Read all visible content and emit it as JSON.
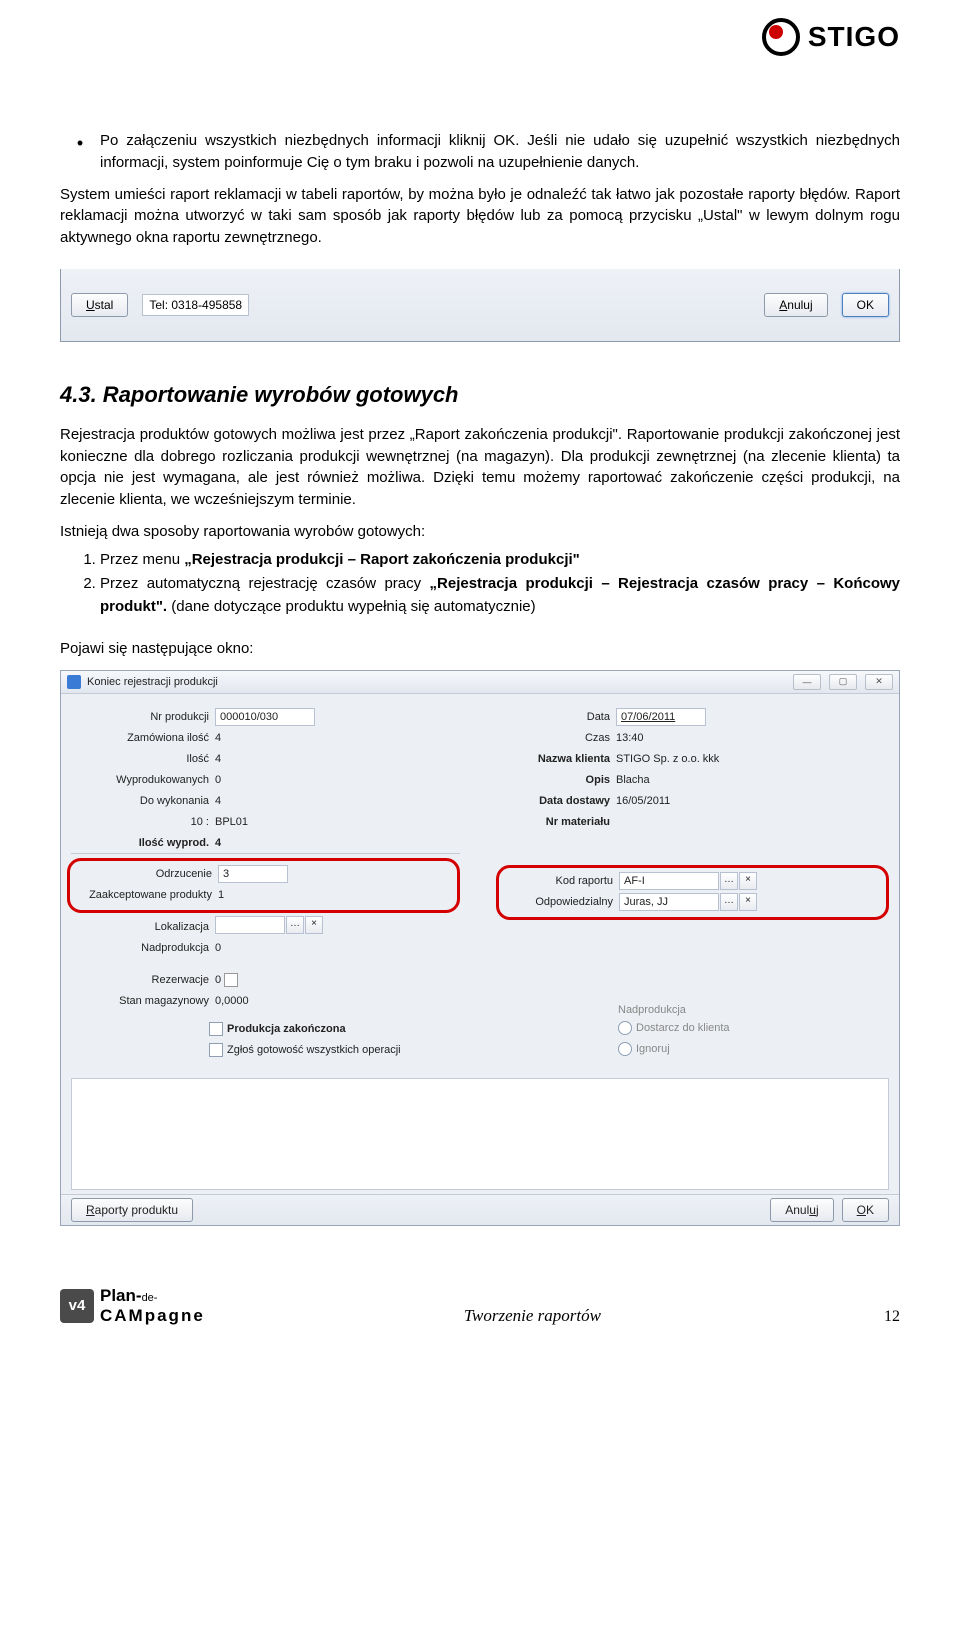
{
  "logo_brand": "STIGO",
  "para_bullet": "Po załączeniu wszystkich niezbędnych informacji kliknij OK. Jeśli nie udało się uzupełnić wszystkich niezbędnych informacji, system poinformuje Cię o tym braku i pozwoli na uzupełnienie danych.",
  "para_after": "System umieści raport reklamacji w tabeli raportów, by można było je odnaleźć tak łatwo jak pozostałe raporty błędów. Raport reklamacji można utworzyć w taki sam sposób jak raporty błędów lub za pomocą przycisku „Ustal\" w lewym dolnym rogu aktywnego okna raportu zewnętrznego.",
  "snippet1": {
    "ustal": "Ustal",
    "tel": "Tel: 0318-495858",
    "anuluj": "Anuluj",
    "ok": "OK"
  },
  "section_heading": "4.3.  Raportowanie wyrobów gotowych",
  "para3": "Rejestracja produktów gotowych możliwa jest przez „Raport zakończenia produkcji\". Raportowanie produkcji zakończonej jest konieczne dla dobrego rozliczania produkcji wewnętrznej (na magazyn). Dla produkcji zewnętrznej (na zlecenie klienta) ta opcja nie jest wymagana, ale jest również możliwa. Dzięki temu możemy raportować zakończenie części produkcji, na zlecenie klienta, we wcześniejszym terminie.",
  "para_list_intro": "Istnieją dwa sposoby raportowania wyrobów gotowych:",
  "enum": {
    "i1_a": "Przez menu ",
    "i1_b": "„Rejestracja produkcji – Raport zakończenia produkcji\"",
    "i2_a": "Przez automatyczną rejestrację czasów pracy ",
    "i2_b": "„Rejestracja produkcji – Rejestracja czasów pracy – Końcowy produkt\". ",
    "i2_c": "(dane dotyczące produktu wypełnią się automatycznie)"
  },
  "para_below_enum": "Pojawi się następujące okno:",
  "win": {
    "title": "Koniec rejestracji produkcji",
    "left": {
      "nr_produkcji_l": "Nr produkcji",
      "nr_produkcji_v": "000010/030",
      "zam_ilosc_l": "Zamówiona ilość",
      "zam_ilosc_v": "4",
      "ilosc_l": "Ilość",
      "ilosc_v": "4",
      "wyprod_l": "Wyprodukowanych",
      "wyprod_v": "0",
      "do_wyk_l": "Do wykonania",
      "do_wyk_v": "4",
      "bpl_a": "10 :",
      "bpl_b": "BPL01",
      "ilosc_wyprod_l": "Ilość wyprod.",
      "ilosc_wyprod_v": "4",
      "odrzucenie_l": "Odrzucenie",
      "odrzucenie_v": "3",
      "zaakc_l": "Zaakceptowane produkty",
      "zaakc_v": "1",
      "lokal_l": "Lokalizacja",
      "lokal_v": "",
      "nadprod_l": "Nadprodukcja",
      "nadprod_v": "0",
      "rezerw_l": "Rezerwacje",
      "rezerw_v": "0",
      "stan_l": "Stan magazynowy",
      "stan_v": "0,0000",
      "chk1": "Produkcja zakończona",
      "chk2": "Zgłoś gotowość wszystkich operacji"
    },
    "right": {
      "data_l": "Data",
      "data_v": "07/06/2011",
      "czas_l": "Czas",
      "czas_v": "13:40",
      "nazwa_l": "Nazwa klienta",
      "nazwa_v": "STIGO Sp. z o.o. kkk",
      "opis_l": "Opis",
      "opis_v": "Blacha",
      "dostawa_l": "Data dostawy",
      "dostawa_v": "16/05/2011",
      "nrmat_l": "Nr materiału",
      "nrmat_v": "",
      "kod_l": "Kod raportu",
      "kod_v": "AF-I",
      "odp_l": "Odpowiedzialny",
      "odp_v": "Juras, JJ",
      "np_hdr": "Nadprodukcja",
      "np_r1": "Dostarcz do klienta",
      "np_r2": "Ignoruj"
    },
    "footer": {
      "raporty": "Raporty produktu",
      "anuluj": "Anuluj",
      "ok": "OK"
    }
  },
  "footer": {
    "brand1": "Plan-",
    "brand_de": "de-",
    "brand2": "CAMpagne",
    "v4": "v4",
    "center": "Tworzenie raportów",
    "page": "12"
  }
}
